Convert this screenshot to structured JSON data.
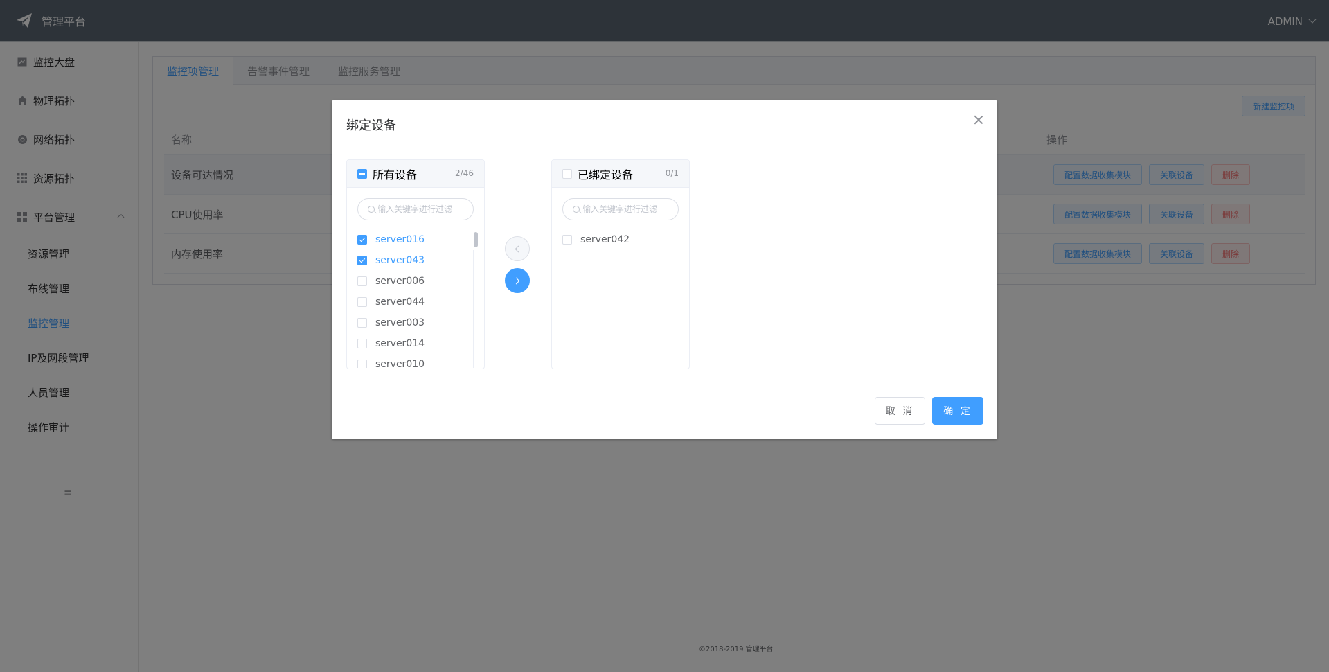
{
  "header": {
    "brand": "管理平台",
    "user": "ADMIN"
  },
  "sidebar": {
    "items": [
      {
        "label": "监控大盘",
        "icon": "chart-icon"
      },
      {
        "label": "物理拓扑",
        "icon": "home-icon"
      },
      {
        "label": "网络拓扑",
        "icon": "globe-icon"
      },
      {
        "label": "资源拓扑",
        "icon": "grid-icon"
      },
      {
        "label": "平台管理",
        "icon": "apps-icon"
      }
    ],
    "sub_items": [
      {
        "label": "资源管理"
      },
      {
        "label": "布线管理"
      },
      {
        "label": "监控管理",
        "active": true
      },
      {
        "label": "IP及网段管理"
      },
      {
        "label": "人员管理"
      },
      {
        "label": "操作审计"
      }
    ]
  },
  "main": {
    "tabs": [
      {
        "label": "监控项管理"
      },
      {
        "label": "告警事件管理"
      },
      {
        "label": "监控服务管理"
      }
    ],
    "new_button": "新建监控项",
    "table": {
      "col_name": "名称",
      "col_ops": "操作",
      "rows": [
        {
          "name": "设备可达情况"
        },
        {
          "name": "CPU使用率"
        },
        {
          "name": "内存使用率"
        }
      ],
      "op_config": "配置数据收集模块",
      "op_link": "关联设备",
      "op_delete": "删除"
    },
    "copyright": "©2018-2019 管理平台"
  },
  "dialog": {
    "title": "绑定设备",
    "left_panel": {
      "title": "所有设备",
      "count": "2/46",
      "filter_placeholder": "输入关键字进行过滤",
      "items": [
        {
          "label": "server016",
          "checked": true
        },
        {
          "label": "server043",
          "checked": true
        },
        {
          "label": "server006",
          "checked": false
        },
        {
          "label": "server044",
          "checked": false
        },
        {
          "label": "server003",
          "checked": false
        },
        {
          "label": "server014",
          "checked": false
        },
        {
          "label": "server010",
          "checked": false
        }
      ]
    },
    "right_panel": {
      "title": "已绑定设备",
      "count": "0/1",
      "filter_placeholder": "输入关键字进行过滤",
      "items": [
        {
          "label": "server042",
          "checked": false
        }
      ]
    },
    "cancel": "取 消",
    "confirm": "确 定"
  },
  "colors": {
    "primary": "#409eff",
    "header_bg": "#5a6773",
    "danger": "#f56c6c"
  }
}
